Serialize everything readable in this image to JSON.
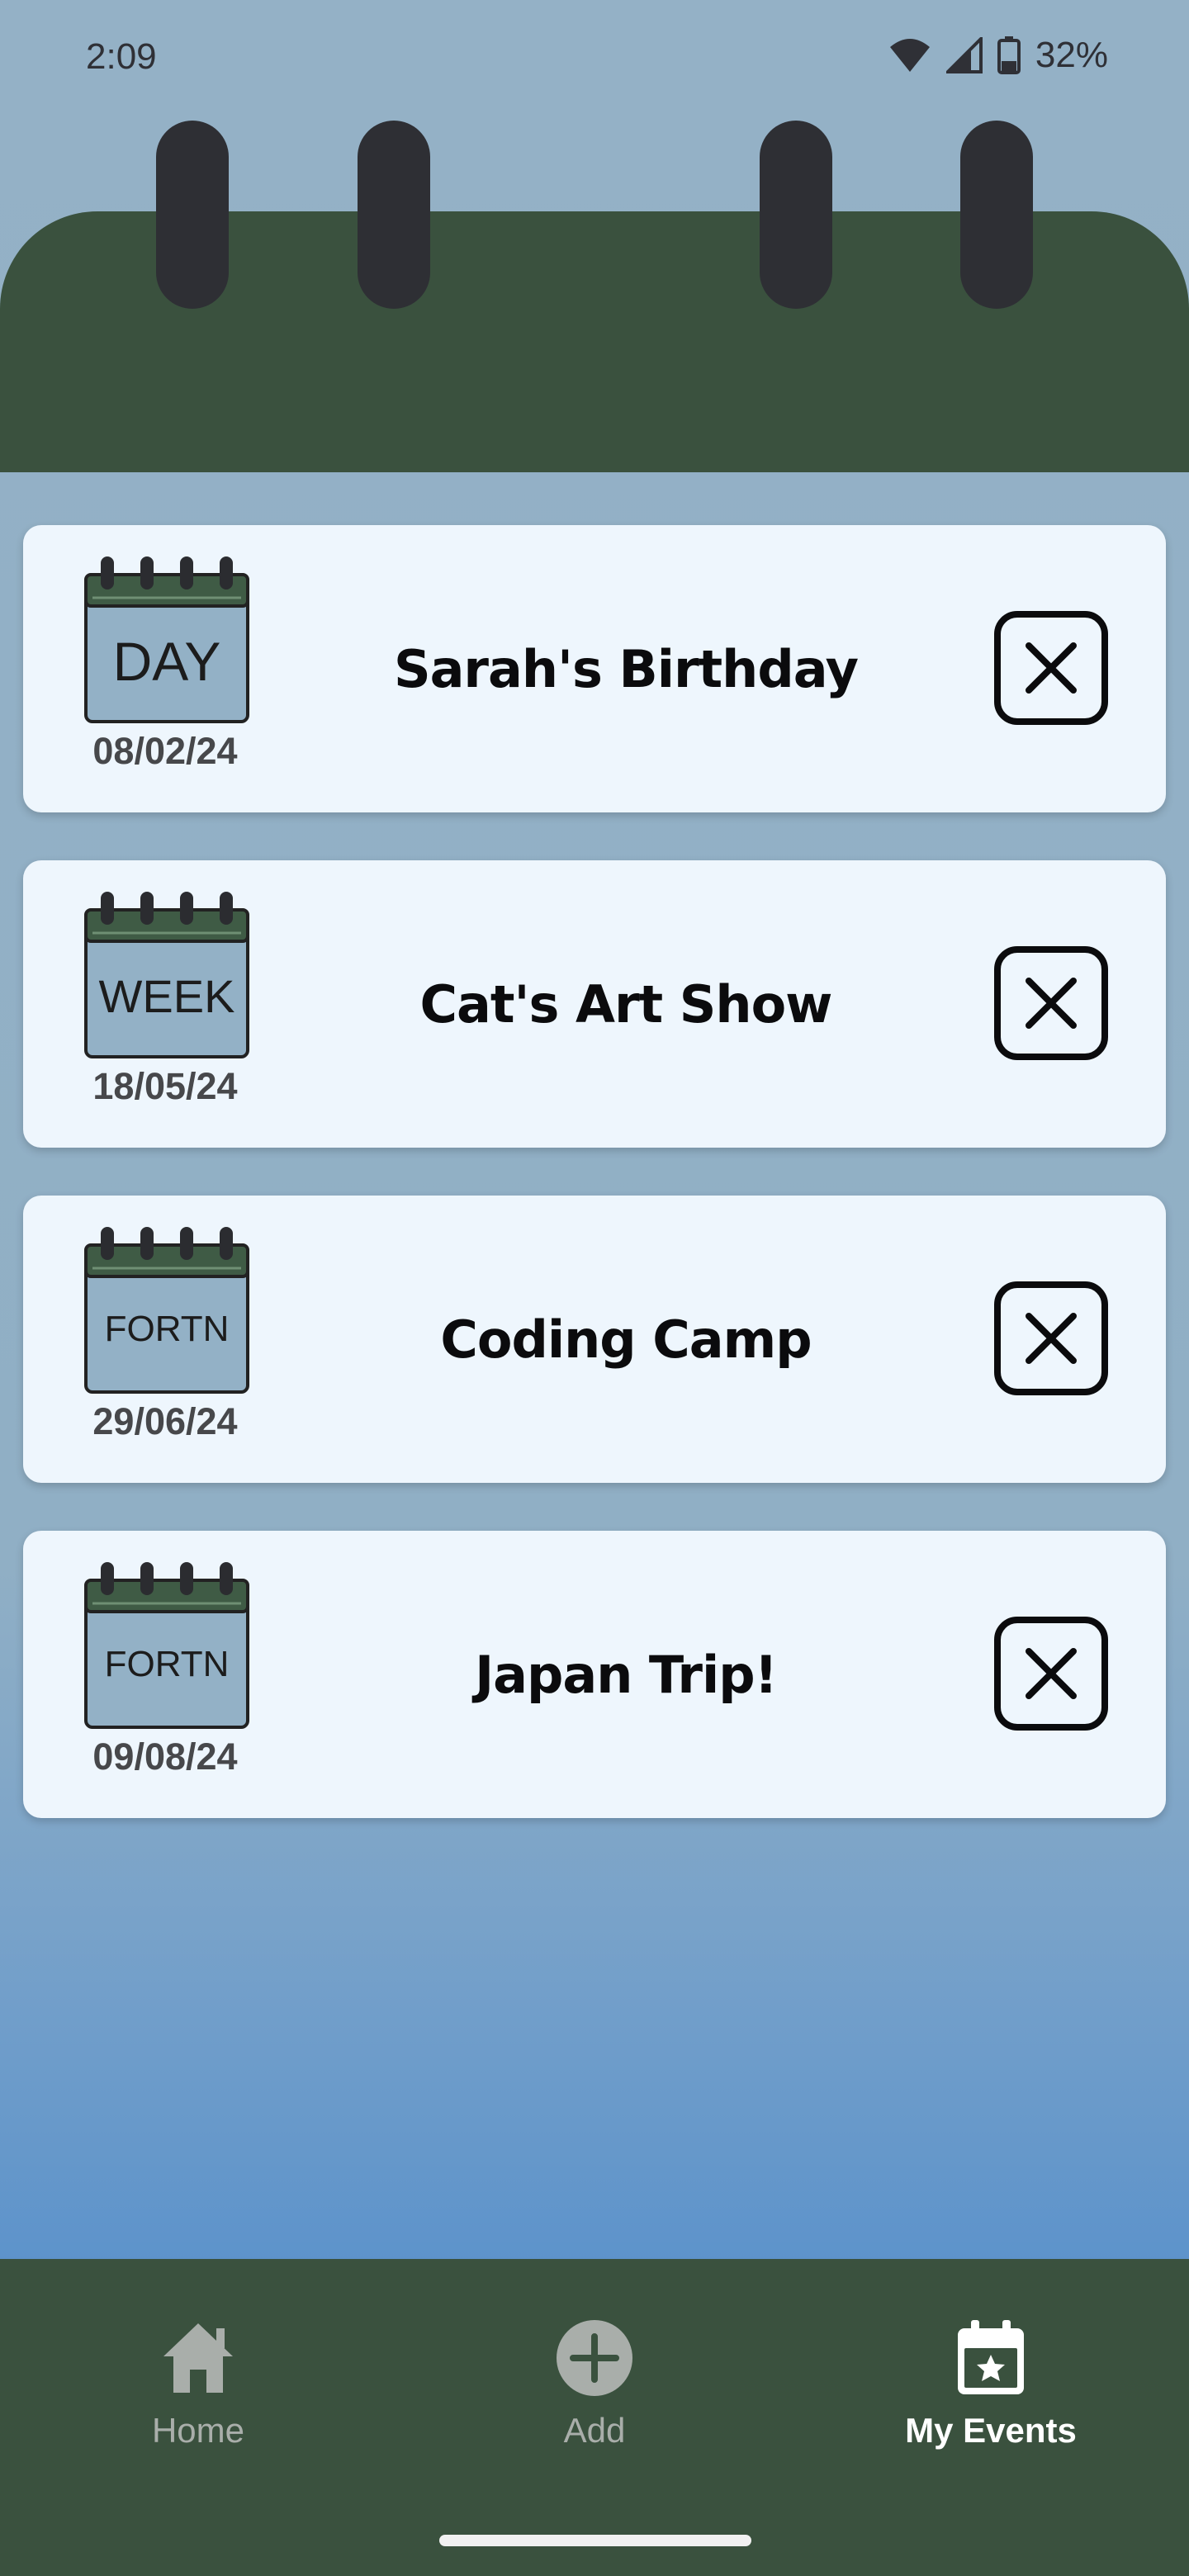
{
  "status_bar": {
    "time": "2:09",
    "battery": "32%"
  },
  "events": [
    {
      "name": "Sarah's Birthday",
      "date": "08/02/24",
      "repeat": "DAY"
    },
    {
      "name": "Cat's Art Show",
      "date": "18/05/24",
      "repeat": "WEEK"
    },
    {
      "name": "Coding Camp",
      "date": "29/06/24",
      "repeat": "FORTN"
    },
    {
      "name": "Japan Trip!",
      "date": "09/08/24",
      "repeat": "FORTN"
    }
  ],
  "nav": {
    "home": "Home",
    "add": "Add",
    "my_events": "My Events"
  },
  "colors": {
    "header_green": "#3a513e",
    "ring": "#2e2f34",
    "card": "#eef6fd",
    "calendar_face": "#93b1c6",
    "nav_inactive": "#a9aeaa",
    "nav_active": "#ffffff"
  },
  "icons": {
    "event_icon": "calendar-icon",
    "delete": "close-icon",
    "home": "home-icon",
    "add": "add-circle-icon",
    "my_events": "calendar-star-icon"
  }
}
